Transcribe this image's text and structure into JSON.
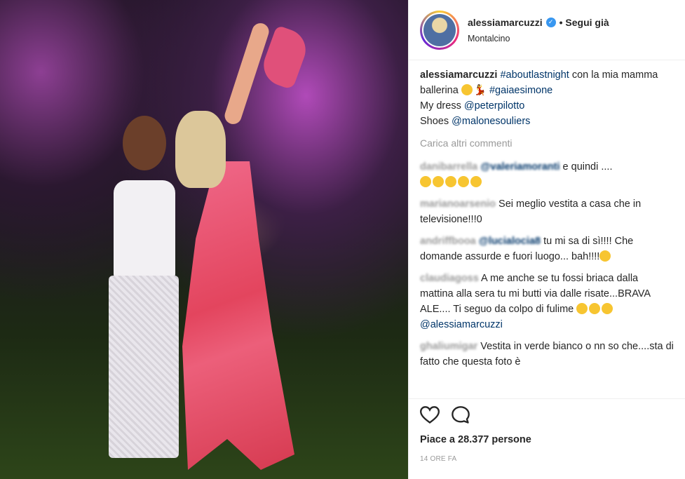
{
  "user": {
    "username": "alessiamarcuzzi",
    "verified": true,
    "follow_status": "• Segui già",
    "location": "Montalcino"
  },
  "caption": {
    "username": "alessiamarcuzzi",
    "hashtag1": "#aboutlastnight",
    "text1": " con la mia mamma ballerina ",
    "hashtag2": "#gaiaesimone",
    "line2_text": "My dress ",
    "line2_tag": "@peterpilotto",
    "line3_text": "Shoes ",
    "line3_tag": "@malonesouliers"
  },
  "load_more": "Carica altri commenti",
  "comments": [
    {
      "user": "danibarrella",
      "tag": "@valeriamoranti",
      "text": "e quindi ....",
      "extra": ""
    },
    {
      "user": "marianoarsenio",
      "tag": "",
      "text": "Sei meglio vestita a casa che in televisione!!!0",
      "extra": ""
    },
    {
      "user": "andriffbooa",
      "tag": "@lucialocia8",
      "text": " tu mi sa di sì!!!! Che domande assurde e fuori luogo... bah!!!!",
      "extra": ""
    },
    {
      "user": "claudiagoss",
      "tag": "",
      "text": "A me anche se tu fossi briaca dalla mattina alla sera tu mi butti via dalle risate...BRAVA ALE.... Ti seguo da colpo di fulime",
      "extra": "@alessiamarcuzzi"
    },
    {
      "user": "ghaliumigar",
      "tag": "",
      "text": "Vestita in verde bianco o nn so che....sta di fatto che questa foto è",
      "extra": ""
    }
  ],
  "likes": "Piace a 28.377 persone",
  "time": "14 ORE FA",
  "icons": [
    "heart-icon",
    "comment-icon"
  ]
}
